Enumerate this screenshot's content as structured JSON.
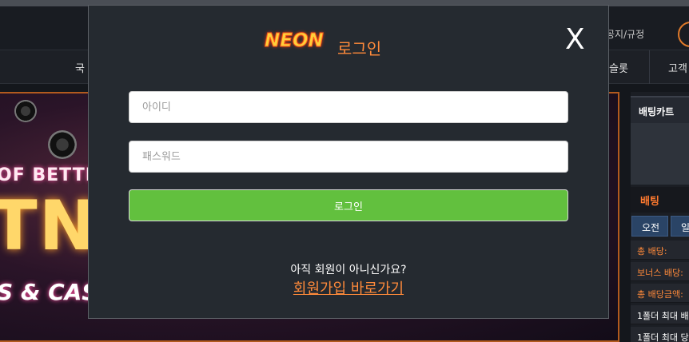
{
  "header": {
    "notice_label": "공지/규정"
  },
  "nav": {
    "left_item": "국",
    "slot_item": "슬롯",
    "support_item": "고객"
  },
  "banner": {
    "line1": "OF BETTING",
    "line2": "TNE",
    "line3": "S & CASINO"
  },
  "right_panel": {
    "cart_title": "배팅카트",
    "bet_title": "배팅",
    "tabs": [
      "오전",
      "일"
    ],
    "rows": [
      {
        "label": "총 배당:",
        "tone": "orange"
      },
      {
        "label": "보너스 배당:",
        "tone": "orange"
      },
      {
        "label": "총 배당금액:",
        "tone": "orange"
      },
      {
        "label": "1폴더 최대 배",
        "tone": "white"
      },
      {
        "label": "1폴더 최대 당",
        "tone": "white"
      }
    ]
  },
  "modal": {
    "logo_text": "NEON",
    "title": "로그인",
    "close_label": "X",
    "id_placeholder": "아이디",
    "id_value": "",
    "password_placeholder": "패스워드",
    "password_value": "",
    "submit_label": "로그인",
    "not_member_text": "아직 회원이 아니신가요?",
    "signup_link": "회원가입 바로가기"
  },
  "colors": {
    "accent_orange": "#ff8a3a",
    "login_button_green": "#62c03e",
    "modal_background": "#252a30"
  }
}
